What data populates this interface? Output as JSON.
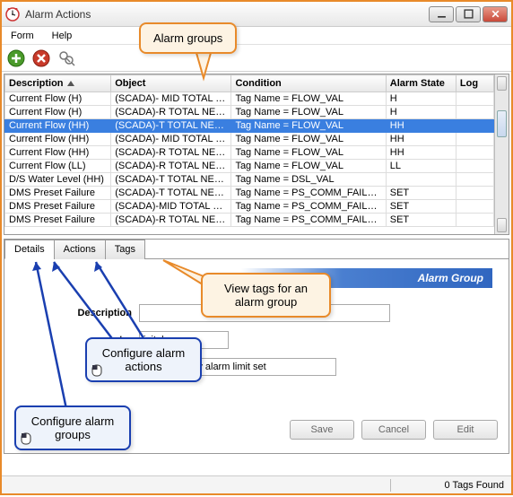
{
  "window": {
    "title": "Alarm Actions"
  },
  "menu": {
    "form": "Form",
    "help": "Help"
  },
  "columns": {
    "description": "Description",
    "object": "Object",
    "condition": "Condition",
    "alarm_state": "Alarm State",
    "log": "Log"
  },
  "rows": [
    {
      "description": "Current Flow (H)",
      "object": "(SCADA)- MID TOTAL NET",
      "condition": "Tag Name = FLOW_VAL",
      "alarm_state": "H",
      "log": ""
    },
    {
      "description": "Current Flow (H)",
      "object": "(SCADA)-R  TOTAL NETW…",
      "condition": "Tag Name = FLOW_VAL",
      "alarm_state": "H",
      "log": ""
    },
    {
      "description": "Current Flow (HH)",
      "object": "(SCADA)-T  TOTAL NET…",
      "condition": "Tag Name = FLOW_VAL",
      "alarm_state": "HH",
      "log": ""
    },
    {
      "description": "Current Flow (HH)",
      "object": "(SCADA)- MID TOTAL NET",
      "condition": "Tag Name = FLOW_VAL",
      "alarm_state": "HH",
      "log": ""
    },
    {
      "description": "Current Flow (HH)",
      "object": "(SCADA)-R  TOTAL NETW…",
      "condition": "Tag Name = FLOW_VAL",
      "alarm_state": "HH",
      "log": ""
    },
    {
      "description": "Current Flow (LL)",
      "object": "(SCADA)-R  TOTAL NETW…",
      "condition": "Tag Name = FLOW_VAL",
      "alarm_state": "LL",
      "log": ""
    },
    {
      "description": "D/S Water Level (HH)",
      "object": "(SCADA)-T  TOTAL NETW.",
      "condition": "Tag Name = DSL_VAL",
      "alarm_state": "",
      "log": ""
    },
    {
      "description": "DMS Preset Failure",
      "object": "(SCADA)-T  TOTAL NETW.",
      "condition": "Tag Name = PS_COMM_FAILU…",
      "alarm_state": "SET",
      "log": ""
    },
    {
      "description": "DMS Preset Failure",
      "object": "(SCADA)-MID TOTAL NET.",
      "condition": "Tag Name = PS_COMM_FAILU…",
      "alarm_state": "SET",
      "log": ""
    },
    {
      "description": "DMS Preset Failure",
      "object": "(SCADA)-R  TOTAL NETW.",
      "condition": "Tag Name = PS_COMM_FAILU…",
      "alarm_state": "SET",
      "log": ""
    }
  ],
  "rows_selected_index": 2,
  "tabs": {
    "details": "Details",
    "actions": "Actions",
    "tags": "Tags"
  },
  "details": {
    "section_title": "Alarm Group",
    "description_label": "Description",
    "description_value": "",
    "filter_label": "ter",
    "filter_value": "igital",
    "when_text": "T - When any alarm limit set"
  },
  "buttons": {
    "save": "Save",
    "cancel": "Cancel",
    "edit": "Edit"
  },
  "status": {
    "tags_found": "0 Tags Found"
  },
  "callouts": {
    "groups": "Alarm groups",
    "view_tags": "View tags for an alarm group",
    "config_actions": "Configure alarm actions",
    "config_groups": "Configure alarm groups"
  }
}
